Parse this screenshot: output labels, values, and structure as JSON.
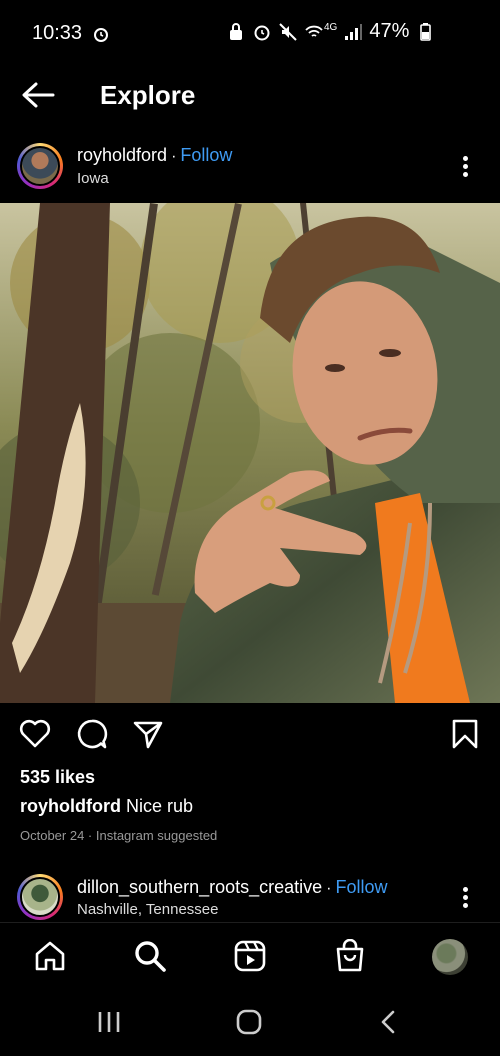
{
  "status_bar": {
    "time": "10:33",
    "network": "4G",
    "battery": "47%"
  },
  "header": {
    "title": "Explore"
  },
  "post": {
    "username": "royholdford",
    "follow_label": "Follow",
    "location": "Iowa",
    "likes": "535 likes",
    "caption_user": "royholdford",
    "caption_text": "Nice rub",
    "meta": "October 24 · Instagram suggested"
  },
  "next_post": {
    "username": "dillon_southern_roots_creative",
    "follow_label": "Follow",
    "location": "Nashville, Tennessee"
  },
  "icons": {
    "actions": [
      "heart-icon",
      "comment-icon",
      "share-icon",
      "bookmark-icon"
    ],
    "bottom_nav": [
      "home-icon",
      "search-icon",
      "reels-icon",
      "shop-icon",
      "profile-avatar"
    ]
  },
  "colors": {
    "follow": "#3f9bf3",
    "background": "#000000"
  }
}
